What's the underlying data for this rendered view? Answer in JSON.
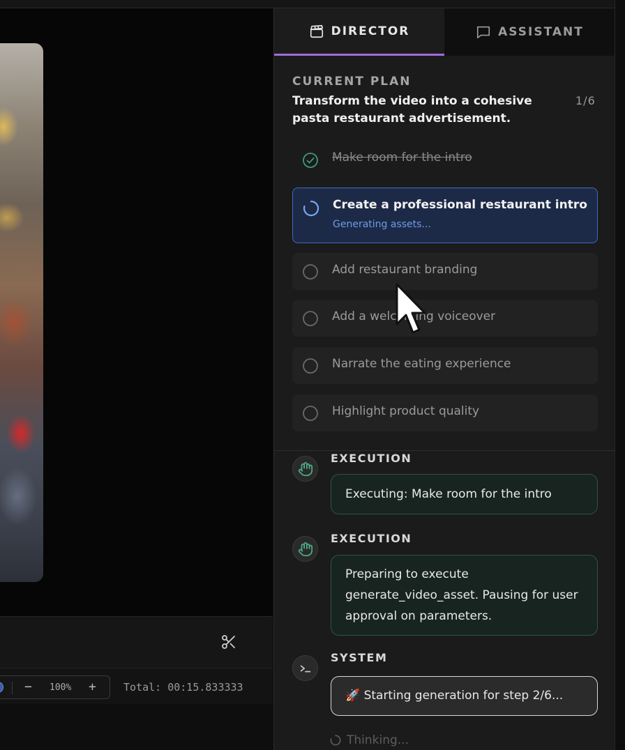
{
  "timeline": {
    "zoom_minus": "−",
    "zoom_value": "100%",
    "zoom_plus": "+",
    "total": "Total: 00:15.833333"
  },
  "tabs": {
    "director": "DIRECTOR",
    "assistant": "ASSISTANT"
  },
  "plan": {
    "title": "CURRENT PLAN",
    "description": "Transform the video into a cohesive pasta restaurant advertisement.",
    "count": "1/6",
    "steps": [
      {
        "label": "Make room for the intro",
        "status": "done"
      },
      {
        "label": "Create a professional restaurant intro",
        "status": "active",
        "sub": "Generating assets..."
      },
      {
        "label": "Add restaurant branding",
        "status": "pending"
      },
      {
        "label": "Add a welcoming voiceover",
        "status": "pending"
      },
      {
        "label": "Narrate the eating experience",
        "status": "pending"
      },
      {
        "label": "Highlight product quality",
        "status": "pending"
      }
    ]
  },
  "logs": [
    {
      "role": "EXECUTION",
      "text": "Executing: Make room for the intro"
    },
    {
      "role": "EXECUTION",
      "text": "Preparing to execute generate_video_asset. Pausing for user approval on parameters."
    },
    {
      "role": "SYSTEM",
      "text": "🚀 Starting generation for step 2/6..."
    }
  ],
  "thinking": "Thinking...",
  "colors": {
    "accent": "#a06ae0",
    "active_border": "#3e67c2",
    "active_sub": "#6d9ce6",
    "done_check": "#3f9a76",
    "exec_border": "#2f5443"
  }
}
